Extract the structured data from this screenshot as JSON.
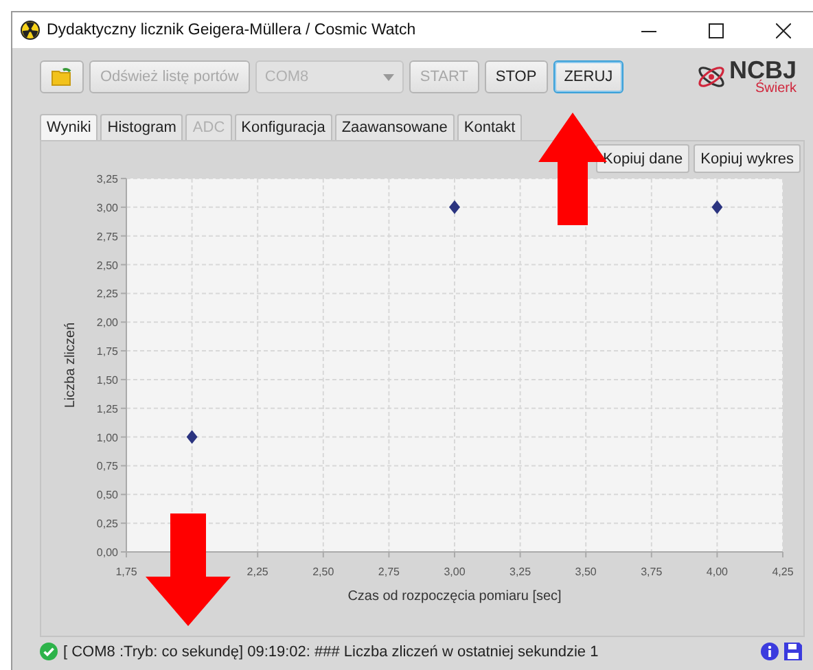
{
  "window": {
    "title": "Dydaktyczny licznik Geigera-Müllera / Cosmic Watch"
  },
  "toolbar": {
    "refresh_button": {
      "label": "Odśwież listę portów",
      "disabled": true
    },
    "port_select": {
      "value": "COM8",
      "disabled": true
    },
    "buttons": [
      {
        "label": "START",
        "disabled": true,
        "focused": false
      },
      {
        "label": "STOP",
        "disabled": false,
        "focused": false
      },
      {
        "label": "ZERUJ",
        "disabled": false,
        "focused": true
      }
    ]
  },
  "logo": {
    "name": "NCBJ",
    "subtitle": "Świerk"
  },
  "tabs": [
    {
      "label": "Wyniki",
      "selected": true,
      "disabled": false
    },
    {
      "label": "Histogram",
      "selected": false,
      "disabled": false
    },
    {
      "label": "ADC",
      "selected": false,
      "disabled": true
    },
    {
      "label": "Konfiguracja",
      "selected": false,
      "disabled": false
    },
    {
      "label": "Zaawansowane",
      "selected": false,
      "disabled": false
    },
    {
      "label": "Kontakt",
      "selected": false,
      "disabled": false
    }
  ],
  "panel_buttons": [
    "Kopiuj dane",
    "Kopiuj wykres"
  ],
  "chart_data": {
    "type": "scatter",
    "xlabel": "Czas od rozpoczęcia pomiaru [sec]",
    "ylabel": "Liczba zliczeń",
    "x": [
      2.0,
      3.0,
      4.0
    ],
    "series": [
      {
        "color": "#2b3480",
        "values": [
          1,
          3,
          3
        ]
      }
    ],
    "grid": true,
    "xlim": [
      1.75,
      4.25
    ],
    "ylim": [
      0,
      3.25
    ],
    "xticks": [
      {
        "value": 1.75,
        "label": "1,75"
      },
      {
        "value": 2.25,
        "label": "2,25"
      },
      {
        "value": 2.5,
        "label": "2,50"
      },
      {
        "value": 2.75,
        "label": "2,75"
      },
      {
        "value": 3.0,
        "label": "3,00"
      },
      {
        "value": 3.25,
        "label": "3,25"
      },
      {
        "value": 3.5,
        "label": "3,50"
      },
      {
        "value": 3.75,
        "label": "3,75"
      },
      {
        "value": 4.0,
        "label": "4,00"
      },
      {
        "value": 4.25,
        "label": "4,25"
      }
    ],
    "yticks": [
      {
        "value": 0,
        "label": "0,00"
      },
      {
        "value": 0.25,
        "label": "0,25"
      },
      {
        "value": 0.5,
        "label": "0,50"
      },
      {
        "value": 0.75,
        "label": "0,75"
      },
      {
        "value": 1.0,
        "label": "1,00"
      },
      {
        "value": 1.25,
        "label": "1,25"
      },
      {
        "value": 1.5,
        "label": "1,50"
      },
      {
        "value": 1.75,
        "label": "1,75"
      },
      {
        "value": 2.0,
        "label": "2,00"
      },
      {
        "value": 2.25,
        "label": "2,25"
      },
      {
        "value": 2.5,
        "label": "2,50"
      },
      {
        "value": 2.75,
        "label": "2,75"
      },
      {
        "value": 3.0,
        "label": "3,00"
      },
      {
        "value": 3.25,
        "label": "3,25"
      }
    ]
  },
  "status_bar": {
    "text": "[ COM8 :Tryb: co sekundę] 09:19:02: ### Liczba zliczeń w ostatniej sekundzie 1"
  }
}
